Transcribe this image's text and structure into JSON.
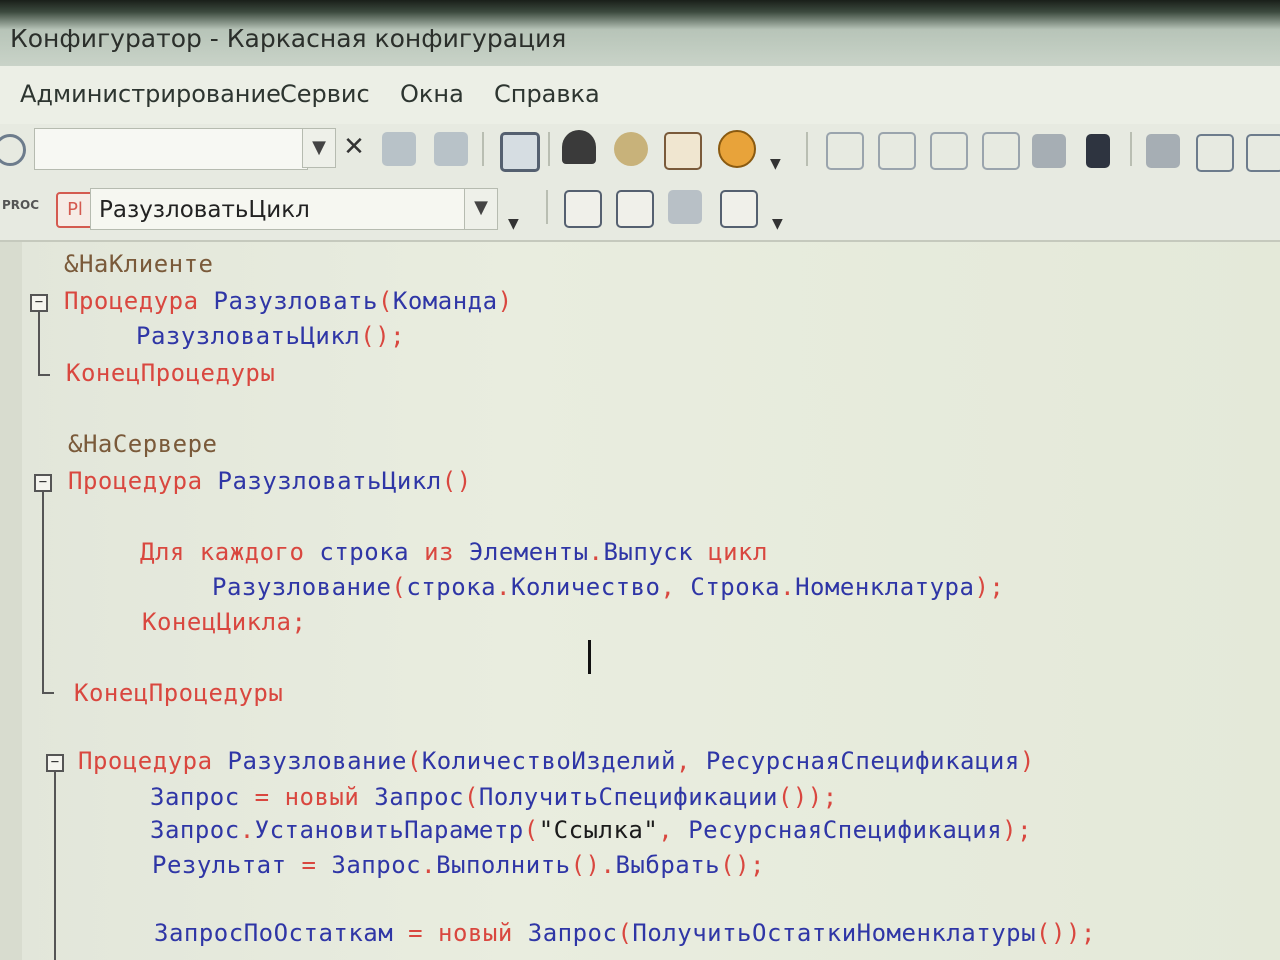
{
  "window": {
    "title": "Конфигуратор - Каркасная конфигурация"
  },
  "menu": {
    "items": [
      "Администрирование",
      "Сервис",
      "Окна",
      "Справка"
    ]
  },
  "toolbar": {
    "search_value": "",
    "procedure_badge": "Pl",
    "procedure_label": "PROC",
    "current_procedure": "РазузловатьЦикл"
  },
  "code": {
    "l1": "&НаКлиенте",
    "l2": {
      "kw": "Процедура",
      "name": "Разузловать",
      "op": "(",
      "arg": "Команда",
      "cl": ")"
    },
    "l3": {
      "call": "РазузловатьЦикл",
      "end": "();"
    },
    "l4": "КонецПроцедуры",
    "l5": "&НаСервере",
    "l6": {
      "kw": "Процедура",
      "name": "РазузловатьЦикл",
      "end": "()"
    },
    "l7": {
      "kw1": "Для каждого",
      "var": "строка",
      "kw2": "из",
      "obj": "Элементы",
      "dot": ".",
      "prop": "Выпуск",
      "kw3": "цикл"
    },
    "l8": {
      "fn": "Разузлование",
      "op": "(",
      "a1": "строка",
      "d1": ".",
      "p1": "Количество",
      "sep": ",",
      "a2": "Строка",
      "d2": ".",
      "p2": "Номенклатура",
      "end": ");"
    },
    "l9": "КонецЦикла;",
    "l10": "КонецПроцедуры",
    "l11": {
      "kw": "Процедура",
      "name": "Разузлование",
      "op": "(",
      "a1": "КоличествоИзделий",
      "sep": ",",
      "a2": "РесурснаяСпецификация",
      "cl": ")"
    },
    "l12": {
      "v": "Запрос",
      "eq": "=",
      "kw": "новый",
      "t": "Запрос",
      "op": "(",
      "f": "ПолучитьСпецификации",
      "end": "());"
    },
    "l13": {
      "v": "Запрос",
      "dot": ".",
      "m": "УстановитьПараметр",
      "op": "(",
      "str": "\"Ссылка\"",
      "sep": ",",
      "a": "РесурснаяСпецификация",
      "end": ");"
    },
    "l14": {
      "v": "Результат",
      "eq": "=",
      "o": "Запрос",
      "d1": ".",
      "m1": "Выполнить",
      "p1": "()",
      "d2": ".",
      "m2": "Выбрать",
      "end": "();"
    },
    "l15": {
      "v": "ЗапросПоОстаткам",
      "eq": "=",
      "kw": "новый",
      "t": "Запрос",
      "op": "(",
      "f": "ПолучитьОстаткиНоменклатуры",
      "end": "());"
    }
  }
}
